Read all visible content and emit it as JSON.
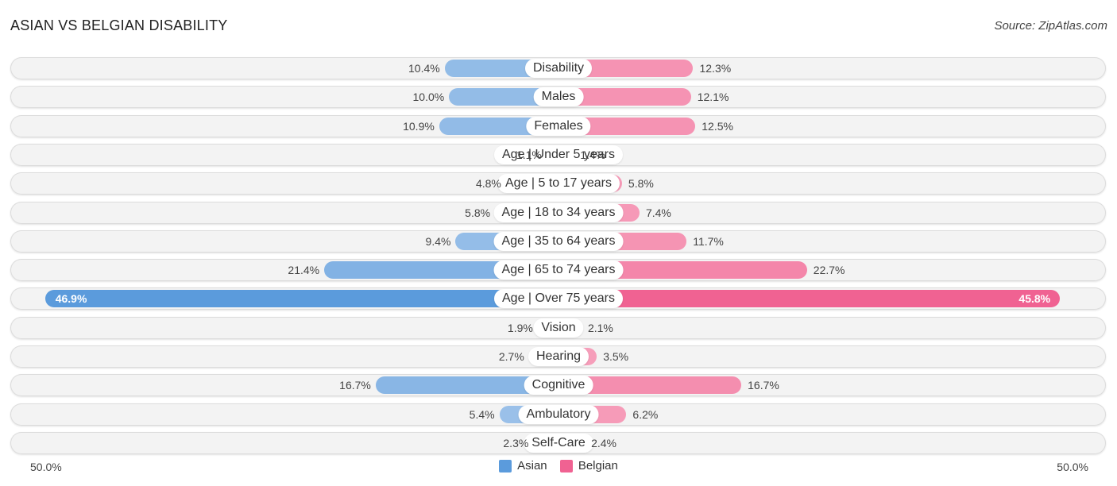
{
  "header": {
    "title": "ASIAN VS BELGIAN DISABILITY",
    "source": "Source: ZipAtlas.com"
  },
  "colors": {
    "asian": "#5b9bdc",
    "belgian": "#f06292",
    "asian_light": "#a9c9ec",
    "belgian_light": "#f7a8c1"
  },
  "chart_data": {
    "type": "bar",
    "orientation": "horizontal-diverging",
    "title": "ASIAN VS BELGIAN DISABILITY",
    "categories": [
      "Disability",
      "Males",
      "Females",
      "Age | Under 5 years",
      "Age | 5 to 17 years",
      "Age | 18 to 34 years",
      "Age | 35 to 64 years",
      "Age | 65 to 74 years",
      "Age | Over 75 years",
      "Vision",
      "Hearing",
      "Cognitive",
      "Ambulatory",
      "Self-Care"
    ],
    "series": [
      {
        "name": "Asian",
        "side": "left",
        "values": [
          10.4,
          10.0,
          10.9,
          1.1,
          4.8,
          5.8,
          9.4,
          21.4,
          46.9,
          1.9,
          2.7,
          16.7,
          5.4,
          2.3
        ],
        "labels": [
          "10.4%",
          "10.0%",
          "10.9%",
          "1.1%",
          "4.8%",
          "5.8%",
          "9.4%",
          "21.4%",
          "46.9%",
          "1.9%",
          "2.7%",
          "16.7%",
          "5.4%",
          "2.3%"
        ]
      },
      {
        "name": "Belgian",
        "side": "right",
        "values": [
          12.3,
          12.1,
          12.5,
          1.4,
          5.8,
          7.4,
          11.7,
          22.7,
          45.8,
          2.1,
          3.5,
          16.7,
          6.2,
          2.4
        ],
        "labels": [
          "12.3%",
          "12.1%",
          "12.5%",
          "1.4%",
          "5.8%",
          "7.4%",
          "11.7%",
          "22.7%",
          "45.8%",
          "2.1%",
          "3.5%",
          "16.7%",
          "6.2%",
          "2.4%"
        ]
      }
    ],
    "xlim": [
      -50,
      50
    ],
    "axis_labels": {
      "left": "50.0%",
      "right": "50.0%"
    },
    "unit": "%",
    "legend": {
      "position": "bottom-center",
      "entries": [
        "Asian",
        "Belgian"
      ]
    }
  }
}
